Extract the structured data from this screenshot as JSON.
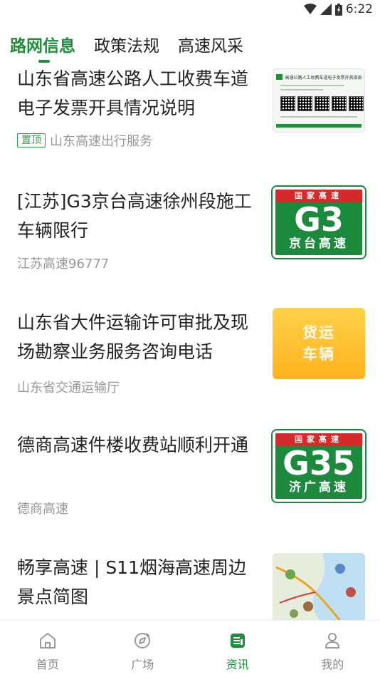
{
  "status_bar": {
    "time": "6:22"
  },
  "tabs": [
    {
      "label": "路网信息",
      "active": true
    },
    {
      "label": "政策法规",
      "active": false
    },
    {
      "label": "高速风采",
      "active": false
    }
  ],
  "news": [
    {
      "title": "山东省高速公路人工收费车道电子发票开具情况说明",
      "pin_label": "置顶",
      "source": "山东高速出行服务",
      "thumb": {
        "kind": "document",
        "header_text": "高速公路人工收费车道电子发票开具指南卡"
      }
    },
    {
      "title": "[江苏]G3京台高速徐州段施工车辆限行",
      "source": "江苏高速96777",
      "thumb": {
        "kind": "sign",
        "top": "国家高速",
        "code": "G3",
        "name": "京台高速"
      }
    },
    {
      "title": "山东省大件运输许可审批及现场勘察业务服务咨询电话",
      "source": "山东省交通运输厅",
      "thumb": {
        "kind": "orange",
        "line1": "货运",
        "line2": "车辆"
      }
    },
    {
      "title": "德商高速件楼收费站顺利开通",
      "source": "德商高速",
      "thumb": {
        "kind": "sign",
        "top": "国家高速",
        "code": "G35",
        "name": "济广高速"
      }
    },
    {
      "title": "畅享高速 | S11烟海高速周边景点简图",
      "source": "",
      "thumb": {
        "kind": "map"
      }
    }
  ],
  "bottom_nav": [
    {
      "label": "首页",
      "icon": "home-icon",
      "active": false
    },
    {
      "label": "广场",
      "icon": "compass-icon",
      "active": false
    },
    {
      "label": "资讯",
      "icon": "news-icon",
      "active": true
    },
    {
      "label": "我的",
      "icon": "user-icon",
      "active": false
    }
  ],
  "colors": {
    "accent": "#1f8f3e",
    "sign_red": "#d42a2a",
    "sign_green": "#1c8a3c",
    "orange": "#ffb21c"
  }
}
